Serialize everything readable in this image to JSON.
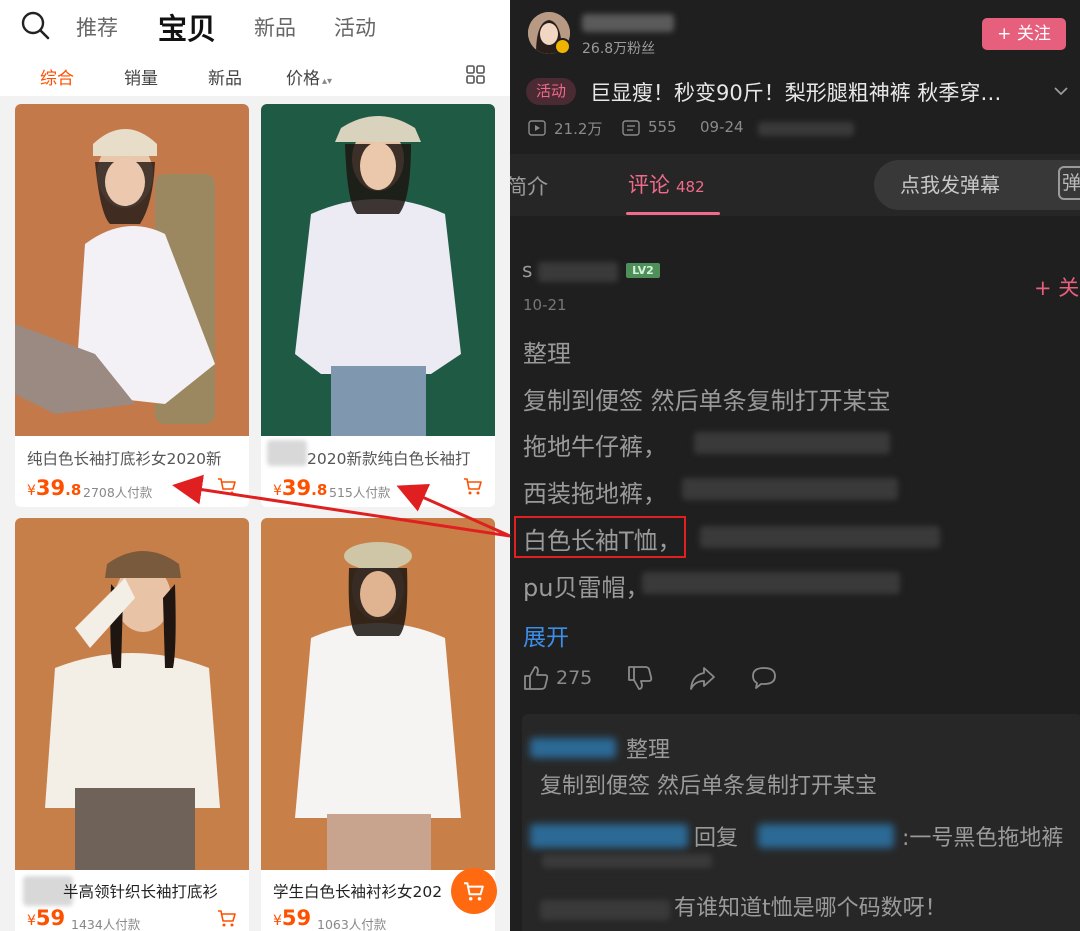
{
  "shop": {
    "nav_tabs": [
      "推荐",
      "宝贝",
      "新品",
      "活动"
    ],
    "sort_items": [
      "综合",
      "销量",
      "新品",
      "价格"
    ],
    "products": [
      {
        "title": "纯白色长袖打底衫女2020新",
        "currency": "¥",
        "price_int": "39",
        "price_dec": ".8",
        "sales": "2708人付款",
        "img_color": "#c4794a",
        "img_color2": "#b56a3c"
      },
      {
        "title": "2020新款纯白色长袖打",
        "currency": "¥",
        "price_int": "39",
        "price_dec": ".8",
        "sales": "515人付款",
        "img_color": "#1f5a45",
        "img_color2": "#174a39"
      },
      {
        "title": "半高领针织长袖打底衫",
        "currency": "¥",
        "price_int": "59",
        "price_dec": "",
        "sales": "1434人付款",
        "img_color": "#c77f4a",
        "img_color2": "#b97340"
      },
      {
        "title": "学生白色长袖衬衫女202",
        "currency": "¥",
        "price_int": "59",
        "price_dec": "",
        "sales": "1063人付款",
        "img_color": "#c98048",
        "img_color2": "#bb7440"
      }
    ]
  },
  "video": {
    "fans": "26.8万粉丝",
    "follow_label": "+ 关注",
    "activity_tag": "活动",
    "title": "巨显瘦！秒变90斤！梨形腿粗神裤 秋季穿…",
    "views": "21.2万",
    "danmaku_count": "555",
    "date": "09-24",
    "tab_intro": "简介",
    "tab_comments": "评论",
    "comment_count": "482",
    "danmaku_placeholder": "点我发弹幕",
    "danmaku_icon": "弹"
  },
  "comment": {
    "user": "s",
    "level": "LV2",
    "follow": "+ 关",
    "date": "10-21",
    "lines": [
      "整理",
      "复制到便签 然后单条复制打开某宝",
      "拖地牛仔裤，",
      "西装拖地裤，",
      "白色长袖T恤，",
      "pu贝雷帽，"
    ],
    "expand": "展开",
    "likes": "275"
  },
  "replies": {
    "first_label": "整理",
    "first_body": "复制到便签 然后单条复制打开某宝",
    "reply_word": "回复",
    "reply_text": ":一号黑色拖地裤",
    "question": "有谁知道t恤是哪个码数呀！"
  },
  "colors": {
    "taobao_orange": "#ff5000",
    "bili_pink": "#f06a8a",
    "highlight_red": "#e02020"
  },
  "icons": [
    "search-icon",
    "sort-arrows-icon",
    "grid-layout-icon",
    "cart-icon",
    "play-icon",
    "danmaku-icon",
    "chevron-down-icon",
    "thumbs-up-icon",
    "thumbs-down-icon",
    "share-icon",
    "comment-icon"
  ]
}
